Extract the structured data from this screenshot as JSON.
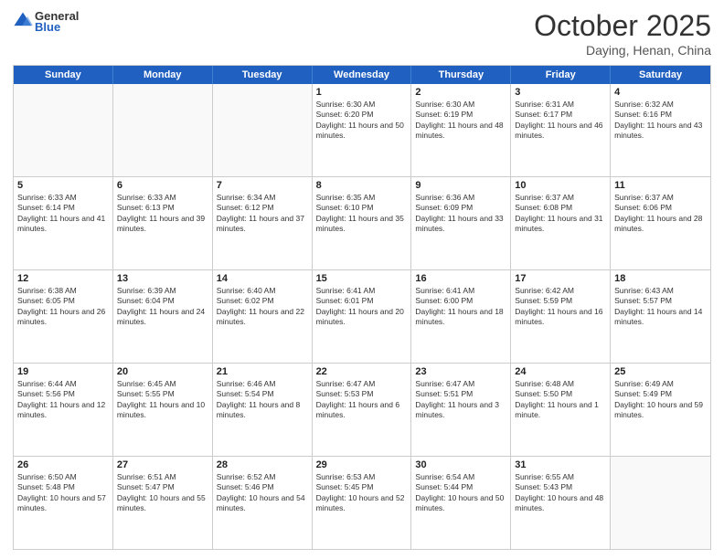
{
  "header": {
    "logo_general": "General",
    "logo_blue": "Blue",
    "title": "October 2025",
    "location": "Daying, Henan, China"
  },
  "days_of_week": [
    "Sunday",
    "Monday",
    "Tuesday",
    "Wednesday",
    "Thursday",
    "Friday",
    "Saturday"
  ],
  "weeks": [
    [
      {
        "day": "",
        "sunrise": "",
        "sunset": "",
        "daylight": ""
      },
      {
        "day": "",
        "sunrise": "",
        "sunset": "",
        "daylight": ""
      },
      {
        "day": "",
        "sunrise": "",
        "sunset": "",
        "daylight": ""
      },
      {
        "day": "1",
        "sunrise": "Sunrise: 6:30 AM",
        "sunset": "Sunset: 6:20 PM",
        "daylight": "Daylight: 11 hours and 50 minutes."
      },
      {
        "day": "2",
        "sunrise": "Sunrise: 6:30 AM",
        "sunset": "Sunset: 6:19 PM",
        "daylight": "Daylight: 11 hours and 48 minutes."
      },
      {
        "day": "3",
        "sunrise": "Sunrise: 6:31 AM",
        "sunset": "Sunset: 6:17 PM",
        "daylight": "Daylight: 11 hours and 46 minutes."
      },
      {
        "day": "4",
        "sunrise": "Sunrise: 6:32 AM",
        "sunset": "Sunset: 6:16 PM",
        "daylight": "Daylight: 11 hours and 43 minutes."
      }
    ],
    [
      {
        "day": "5",
        "sunrise": "Sunrise: 6:33 AM",
        "sunset": "Sunset: 6:14 PM",
        "daylight": "Daylight: 11 hours and 41 minutes."
      },
      {
        "day": "6",
        "sunrise": "Sunrise: 6:33 AM",
        "sunset": "Sunset: 6:13 PM",
        "daylight": "Daylight: 11 hours and 39 minutes."
      },
      {
        "day": "7",
        "sunrise": "Sunrise: 6:34 AM",
        "sunset": "Sunset: 6:12 PM",
        "daylight": "Daylight: 11 hours and 37 minutes."
      },
      {
        "day": "8",
        "sunrise": "Sunrise: 6:35 AM",
        "sunset": "Sunset: 6:10 PM",
        "daylight": "Daylight: 11 hours and 35 minutes."
      },
      {
        "day": "9",
        "sunrise": "Sunrise: 6:36 AM",
        "sunset": "Sunset: 6:09 PM",
        "daylight": "Daylight: 11 hours and 33 minutes."
      },
      {
        "day": "10",
        "sunrise": "Sunrise: 6:37 AM",
        "sunset": "Sunset: 6:08 PM",
        "daylight": "Daylight: 11 hours and 31 minutes."
      },
      {
        "day": "11",
        "sunrise": "Sunrise: 6:37 AM",
        "sunset": "Sunset: 6:06 PM",
        "daylight": "Daylight: 11 hours and 28 minutes."
      }
    ],
    [
      {
        "day": "12",
        "sunrise": "Sunrise: 6:38 AM",
        "sunset": "Sunset: 6:05 PM",
        "daylight": "Daylight: 11 hours and 26 minutes."
      },
      {
        "day": "13",
        "sunrise": "Sunrise: 6:39 AM",
        "sunset": "Sunset: 6:04 PM",
        "daylight": "Daylight: 11 hours and 24 minutes."
      },
      {
        "day": "14",
        "sunrise": "Sunrise: 6:40 AM",
        "sunset": "Sunset: 6:02 PM",
        "daylight": "Daylight: 11 hours and 22 minutes."
      },
      {
        "day": "15",
        "sunrise": "Sunrise: 6:41 AM",
        "sunset": "Sunset: 6:01 PM",
        "daylight": "Daylight: 11 hours and 20 minutes."
      },
      {
        "day": "16",
        "sunrise": "Sunrise: 6:41 AM",
        "sunset": "Sunset: 6:00 PM",
        "daylight": "Daylight: 11 hours and 18 minutes."
      },
      {
        "day": "17",
        "sunrise": "Sunrise: 6:42 AM",
        "sunset": "Sunset: 5:59 PM",
        "daylight": "Daylight: 11 hours and 16 minutes."
      },
      {
        "day": "18",
        "sunrise": "Sunrise: 6:43 AM",
        "sunset": "Sunset: 5:57 PM",
        "daylight": "Daylight: 11 hours and 14 minutes."
      }
    ],
    [
      {
        "day": "19",
        "sunrise": "Sunrise: 6:44 AM",
        "sunset": "Sunset: 5:56 PM",
        "daylight": "Daylight: 11 hours and 12 minutes."
      },
      {
        "day": "20",
        "sunrise": "Sunrise: 6:45 AM",
        "sunset": "Sunset: 5:55 PM",
        "daylight": "Daylight: 11 hours and 10 minutes."
      },
      {
        "day": "21",
        "sunrise": "Sunrise: 6:46 AM",
        "sunset": "Sunset: 5:54 PM",
        "daylight": "Daylight: 11 hours and 8 minutes."
      },
      {
        "day": "22",
        "sunrise": "Sunrise: 6:47 AM",
        "sunset": "Sunset: 5:53 PM",
        "daylight": "Daylight: 11 hours and 6 minutes."
      },
      {
        "day": "23",
        "sunrise": "Sunrise: 6:47 AM",
        "sunset": "Sunset: 5:51 PM",
        "daylight": "Daylight: 11 hours and 3 minutes."
      },
      {
        "day": "24",
        "sunrise": "Sunrise: 6:48 AM",
        "sunset": "Sunset: 5:50 PM",
        "daylight": "Daylight: 11 hours and 1 minute."
      },
      {
        "day": "25",
        "sunrise": "Sunrise: 6:49 AM",
        "sunset": "Sunset: 5:49 PM",
        "daylight": "Daylight: 10 hours and 59 minutes."
      }
    ],
    [
      {
        "day": "26",
        "sunrise": "Sunrise: 6:50 AM",
        "sunset": "Sunset: 5:48 PM",
        "daylight": "Daylight: 10 hours and 57 minutes."
      },
      {
        "day": "27",
        "sunrise": "Sunrise: 6:51 AM",
        "sunset": "Sunset: 5:47 PM",
        "daylight": "Daylight: 10 hours and 55 minutes."
      },
      {
        "day": "28",
        "sunrise": "Sunrise: 6:52 AM",
        "sunset": "Sunset: 5:46 PM",
        "daylight": "Daylight: 10 hours and 54 minutes."
      },
      {
        "day": "29",
        "sunrise": "Sunrise: 6:53 AM",
        "sunset": "Sunset: 5:45 PM",
        "daylight": "Daylight: 10 hours and 52 minutes."
      },
      {
        "day": "30",
        "sunrise": "Sunrise: 6:54 AM",
        "sunset": "Sunset: 5:44 PM",
        "daylight": "Daylight: 10 hours and 50 minutes."
      },
      {
        "day": "31",
        "sunrise": "Sunrise: 6:55 AM",
        "sunset": "Sunset: 5:43 PM",
        "daylight": "Daylight: 10 hours and 48 minutes."
      },
      {
        "day": "",
        "sunrise": "",
        "sunset": "",
        "daylight": ""
      }
    ]
  ]
}
